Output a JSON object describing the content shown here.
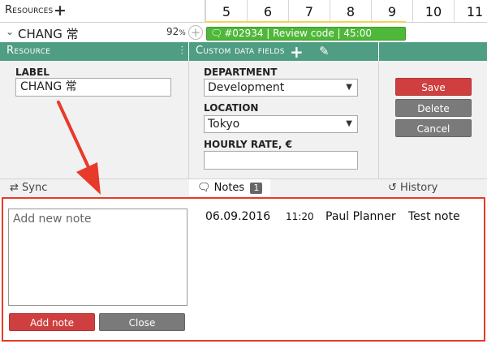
{
  "timeline": {
    "resources_label": "Resources",
    "days": [
      "5",
      "6",
      "7",
      "8",
      "9",
      "10",
      "11"
    ]
  },
  "resource_row": {
    "name": "CHANG 常",
    "utilization_value": "92",
    "utilization_unit": "%",
    "task_label": "#02934 | Review code | 45:00"
  },
  "panels": {
    "resource_title": "Resource",
    "custom_title": "Custom data fields"
  },
  "form": {
    "label_caption": "LABEL",
    "label_value": "CHANG 常",
    "department_caption": "DEPARTMENT",
    "department_value": "Development",
    "location_caption": "LOCATION",
    "location_value": "Tokyo",
    "rate_caption": "HOURLY RATE, €",
    "rate_value": ""
  },
  "actions": {
    "save": "Save",
    "delete": "Delete",
    "cancel": "Cancel"
  },
  "tabs": {
    "sync": "Sync",
    "notes": "Notes",
    "notes_count": "1",
    "history": "History"
  },
  "notes": {
    "placeholder": "Add new note",
    "add_button": "Add note",
    "close_button": "Close",
    "items": [
      {
        "date": "06.09.2016",
        "time": "11:20",
        "author": "Paul Planner",
        "text": "Test note"
      }
    ]
  },
  "colors": {
    "accent_green": "#4f9d83",
    "task_green": "#4fb83a",
    "save_red": "#cf3f3f",
    "highlight_red": "#e83a2a"
  }
}
